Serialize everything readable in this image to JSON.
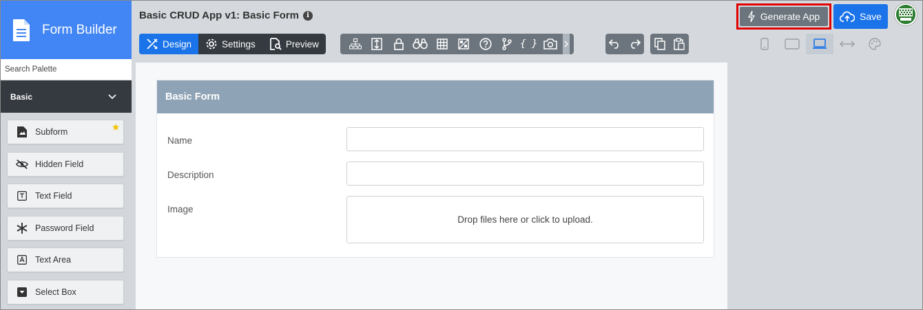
{
  "brand": {
    "title": "Form Builder",
    "icon": "document-icon"
  },
  "sidebar": {
    "search_placeholder": "Search Palette",
    "group_label": "Basic",
    "items": [
      {
        "label": "Subform",
        "icon": "subform-icon",
        "starred": true
      },
      {
        "label": "Hidden Field",
        "icon": "eye-slash-icon"
      },
      {
        "label": "Text Field",
        "icon": "text-field-icon"
      },
      {
        "label": "Password Field",
        "icon": "asterisk-icon"
      },
      {
        "label": "Text Area",
        "icon": "text-area-icon"
      },
      {
        "label": "Select Box",
        "icon": "select-box-icon"
      }
    ]
  },
  "header": {
    "title": "Basic CRUD App v1: Basic Form",
    "info_icon": "i",
    "tabs": [
      {
        "label": "Design",
        "active": true
      },
      {
        "label": "Settings",
        "active": false
      },
      {
        "label": "Preview",
        "active": false
      }
    ],
    "tools": [
      "sitemap-icon",
      "form-icon",
      "lock-icon",
      "binoculars-icon",
      "table-icon",
      "image-icon",
      "help-icon",
      "branch-icon",
      "json-icon",
      "camera-icon"
    ],
    "json_glyph": "{ }",
    "generate_label": "Generate App",
    "save_label": "Save",
    "devices": [
      "phone-icon",
      "tablet-icon",
      "laptop-icon",
      "fluid-icon",
      "palette-icon"
    ],
    "active_device": "laptop-icon"
  },
  "colors": {
    "accent": "#1a73e8",
    "brand": "#4285f4",
    "dark": "#343a40",
    "highlight": "#e00000",
    "card_header": "#8fa3b6"
  },
  "form": {
    "title": "Basic Form",
    "fields": [
      {
        "label": "Name",
        "type": "text",
        "value": ""
      },
      {
        "label": "Description",
        "type": "text",
        "value": ""
      },
      {
        "label": "Image",
        "type": "file",
        "dropzone_text": "Drop files here or click to upload."
      }
    ]
  }
}
